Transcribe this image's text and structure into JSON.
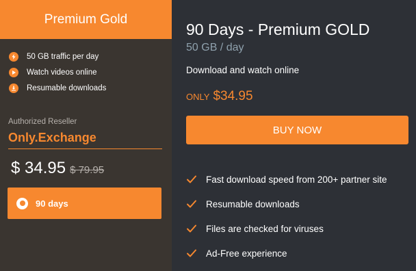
{
  "colors": {
    "accent": "#f7882f",
    "left_bg": "#3a3530",
    "right_bg": "#2d3036",
    "muted": "#b7b2ad",
    "subtitle": "#8fa1ad"
  },
  "plan": {
    "name": "Premium Gold",
    "features": [
      {
        "icon": "lightning-icon",
        "label": "50 GB traffic per day"
      },
      {
        "icon": "play-icon",
        "label": "Watch videos online"
      },
      {
        "icon": "download-icon",
        "label": "Resumable downloads"
      }
    ],
    "reseller_label": "Authorized Reseller",
    "reseller_name": "Only.Exchange",
    "price_current": "$ 34.95",
    "price_old": "$ 79.95",
    "duration_option": {
      "label": "90 days",
      "selected": true
    }
  },
  "detail": {
    "title": "90 Days - Premium GOLD",
    "subtitle": "50 GB / day",
    "description": "Download and watch online",
    "only_label": "ONLY",
    "only_price": "$34.95",
    "buy_button": "BUY NOW",
    "benefits": [
      "Fast download speed from 200+ partner site",
      "Resumable downloads",
      "Files are checked for viruses",
      "Ad-Free experience"
    ]
  }
}
